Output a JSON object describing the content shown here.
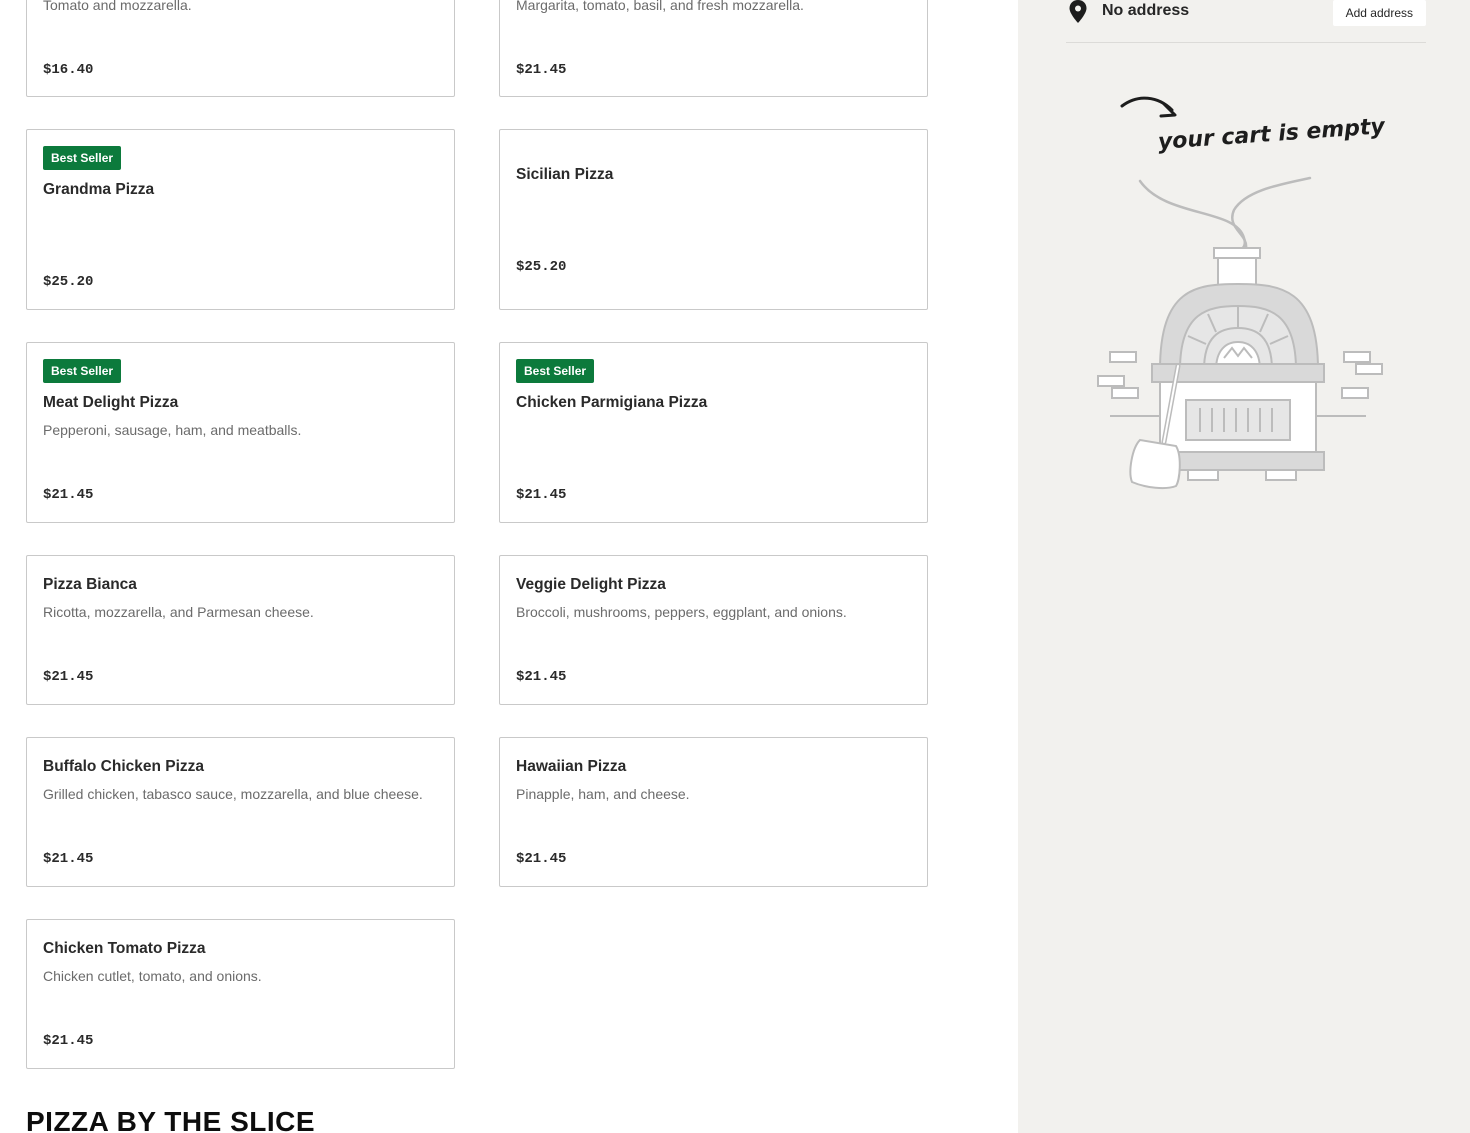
{
  "menu": {
    "items": [
      {
        "badge": "",
        "title": "",
        "desc": "Tomato and mozzarella.",
        "price": "$16.40"
      },
      {
        "badge": "",
        "title": "",
        "desc": "Margarita, tomato, basil, and fresh mozzarella.",
        "price": "$21.45"
      },
      {
        "badge": "Best Seller",
        "title": "Grandma Pizza",
        "desc": "",
        "price": "$25.20"
      },
      {
        "badge": "",
        "title": "Sicilian Pizza",
        "desc": "",
        "price": "$25.20"
      },
      {
        "badge": "Best Seller",
        "title": "Meat Delight Pizza",
        "desc": "Pepperoni, sausage, ham, and meatballs.",
        "price": "$21.45"
      },
      {
        "badge": "Best Seller",
        "title": "Chicken Parmigiana Pizza",
        "desc": "",
        "price": "$21.45"
      },
      {
        "badge": "",
        "title": "Pizza Bianca",
        "desc": "Ricotta, mozzarella, and Parmesan cheese.",
        "price": "$21.45"
      },
      {
        "badge": "",
        "title": "Veggie Delight Pizza",
        "desc": "Broccoli, mushrooms, peppers, eggplant, and onions.",
        "price": "$21.45"
      },
      {
        "badge": "",
        "title": "Buffalo Chicken Pizza",
        "desc": "Grilled chicken, tabasco sauce, mozzarella, and blue cheese.",
        "price": "$21.45"
      },
      {
        "badge": "",
        "title": "Hawaiian Pizza",
        "desc": "Pinapple, ham, and cheese.",
        "price": "$21.45"
      },
      {
        "badge": "",
        "title": "Chicken Tomato Pizza",
        "desc": "Chicken cutlet, tomato, and onions.",
        "price": "$21.45"
      }
    ],
    "next_section_heading": "PIZZA BY THE SLICE"
  },
  "sidebar": {
    "address_text": "No address",
    "add_address_label": "Add address",
    "address_icon": "map-pin-icon",
    "cart_empty_text": "your cart is empty",
    "illustration": "pizza-oven-illustration"
  },
  "colors": {
    "badge_green": "#0c7a3c",
    "sidebar_bg": "#f2f1ee",
    "card_border": "#c9c9c9"
  }
}
